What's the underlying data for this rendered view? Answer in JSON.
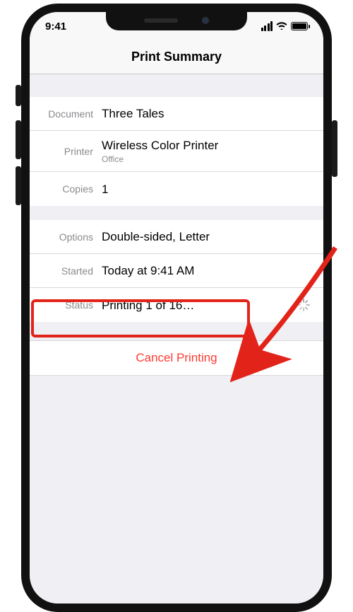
{
  "statusbar": {
    "time": "9:41"
  },
  "header": {
    "title": "Print Summary"
  },
  "rows": {
    "document": {
      "label": "Document",
      "value": "Three Tales"
    },
    "printer": {
      "label": "Printer",
      "value": "Wireless Color Printer",
      "sub": "Office"
    },
    "copies": {
      "label": "Copies",
      "value": "1"
    },
    "options": {
      "label": "Options",
      "value": "Double-sided, Letter"
    },
    "started": {
      "label": "Started",
      "value": "Today at 9:41 AM"
    },
    "status": {
      "label": "Status",
      "value": "Printing 1 of 16…"
    }
  },
  "cancel": {
    "label": "Cancel Printing"
  },
  "annotation": {
    "highlight_target": "status-row",
    "arrow_target": "cancel-button"
  }
}
